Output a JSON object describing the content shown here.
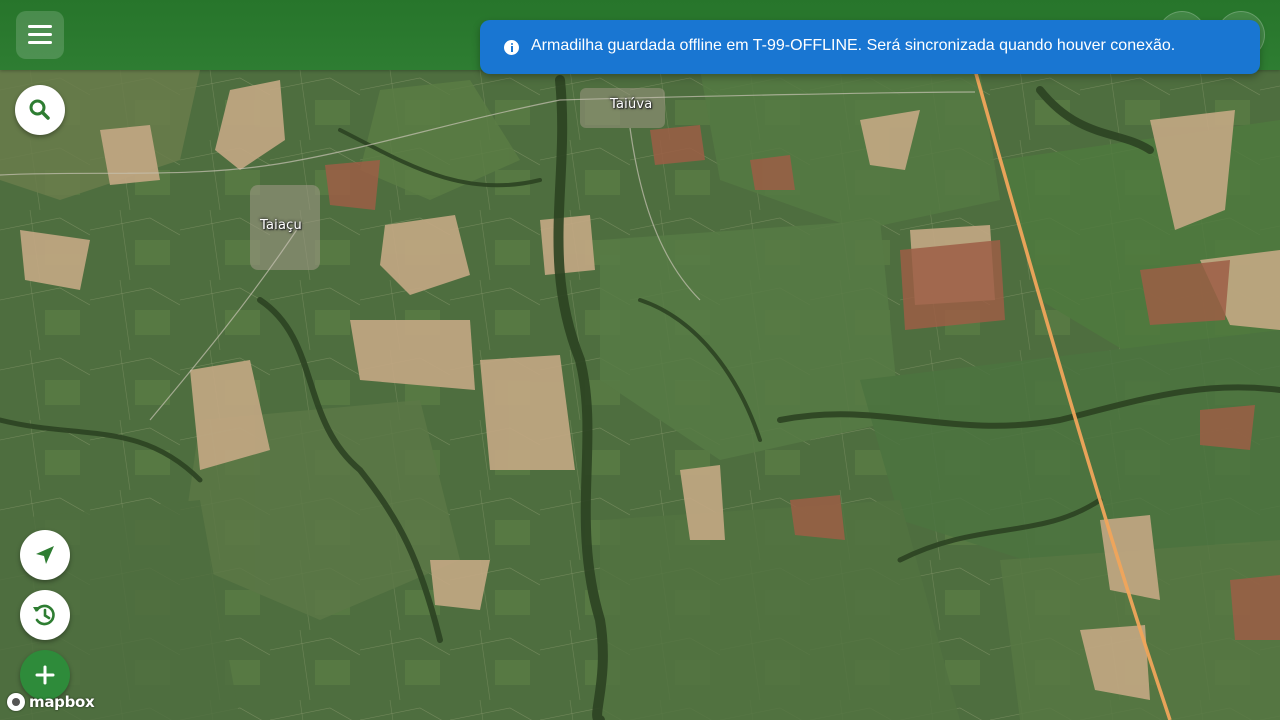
{
  "app": {
    "menu_icon": "hamburger-menu-icon",
    "brand_color": "#2e7d32",
    "accent_add_color": "#2e8b3a"
  },
  "toast": {
    "icon": "info-icon",
    "message": "Armadilha guardada offline em T-99-OFFLINE. Será sincronizada quando houver conexão.",
    "color": "#1976d2"
  },
  "map": {
    "places": [
      {
        "name": "Taiúva"
      },
      {
        "name": "Taiaçu"
      }
    ],
    "attribution": "mapbox"
  },
  "controls": {
    "search_icon": "search-icon",
    "locate_icon": "navigation-arrow-icon",
    "history_icon": "history-icon",
    "add_icon": "plus-icon"
  }
}
